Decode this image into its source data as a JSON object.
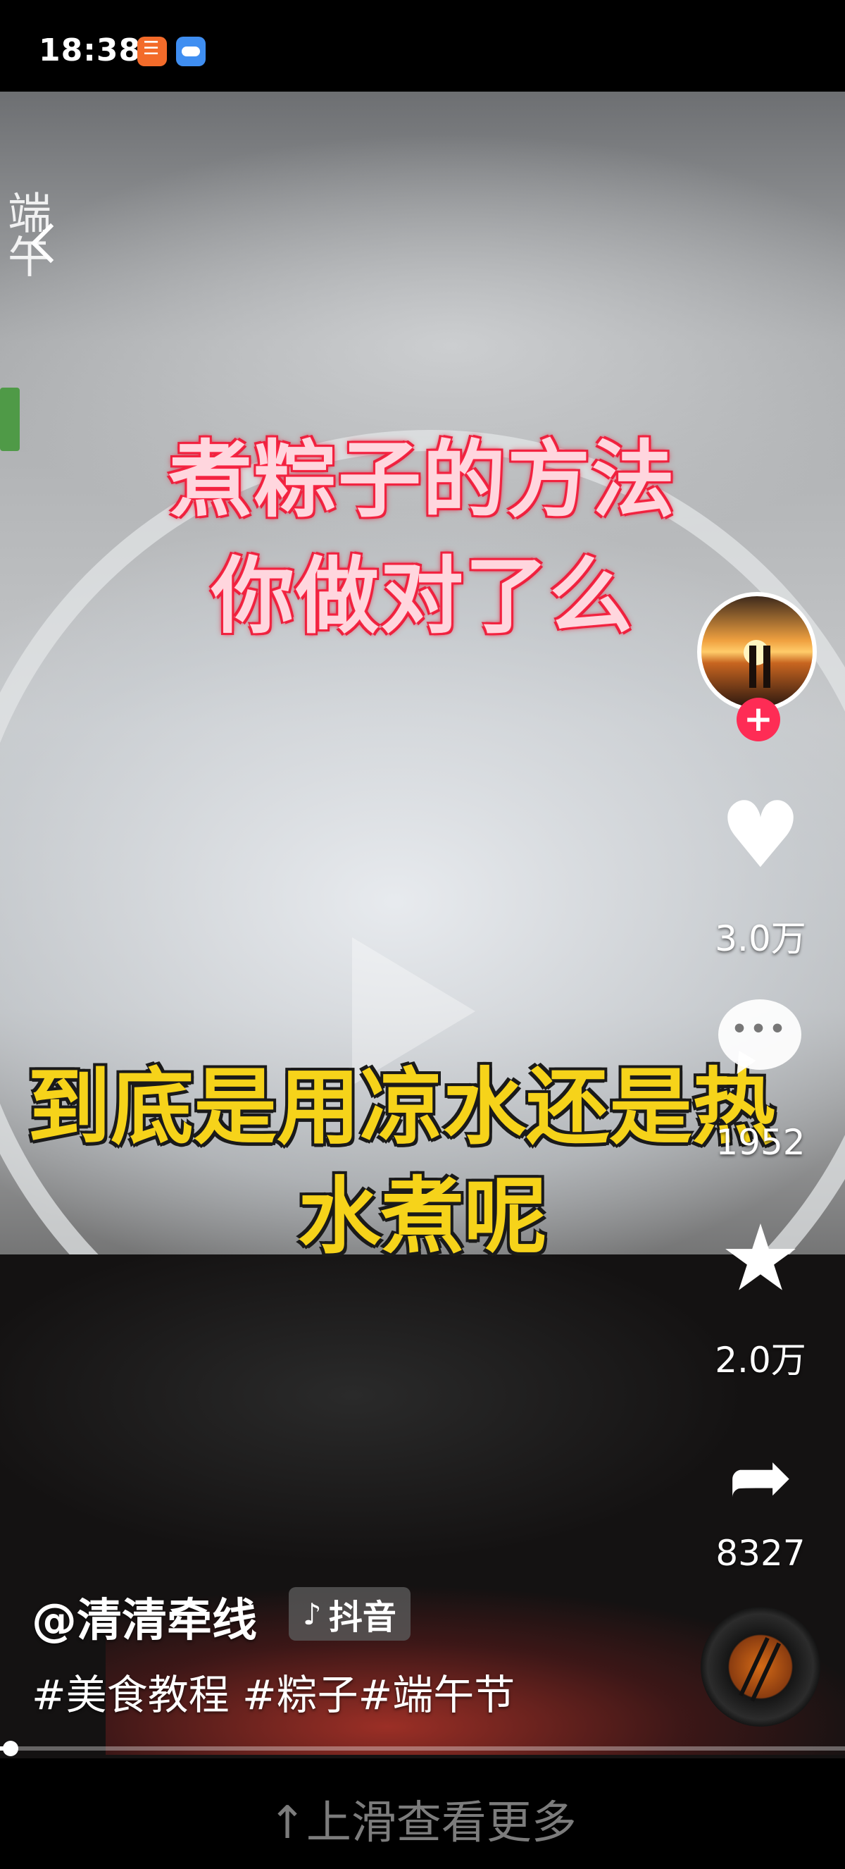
{
  "status_bar": {
    "time": "18:38",
    "icons": [
      "app-notification-icon",
      "cloud-icon"
    ]
  },
  "video": {
    "title_line1": "煮粽子的方法",
    "title_line2": "你做对了么",
    "subtitle_line1": "到底是用凉水还是热",
    "subtitle_line2": "水煮呢",
    "logo_text": "端午"
  },
  "sidebar": {
    "follow_symbol": "+",
    "like_count": "3.0万",
    "comment_count": "1952",
    "favorite_count": "2.0万",
    "share_count": "8327"
  },
  "info": {
    "author": "@清清牵线",
    "platform_tag": "抖音",
    "hashtags": "#美食教程 #粽子#端午节",
    "progress": 0.01
  },
  "bottom": {
    "swipe_hint": "↑上滑查看更多"
  },
  "colors": {
    "follow_accent": "#fe2c55",
    "title_color": "#ff2a48",
    "subtitle_color": "#f6d31a"
  }
}
